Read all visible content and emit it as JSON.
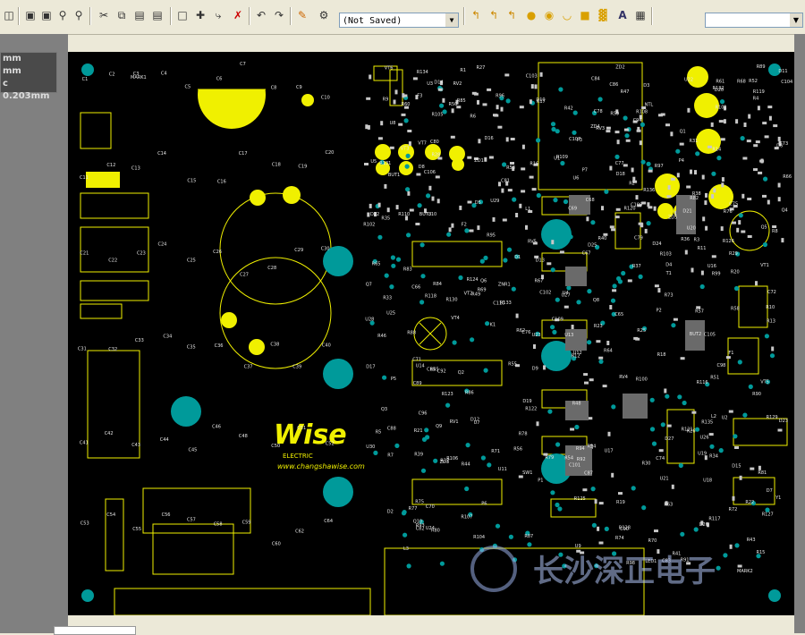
{
  "toolbar": {
    "document_select_value": "(Not Saved)",
    "icons": [
      "save-icon",
      "zoom-area-icon",
      "zoom-fit-icon",
      "zoom-in-icon",
      "zoom-selected-icon",
      "cut-icon",
      "copy-icon",
      "paste-icon",
      "paste-special-icon",
      "select-rect-icon",
      "move-icon",
      "rubber-stamp-icon",
      "cross-probe-icon",
      "undo-icon",
      "redo-icon",
      "highlight-icon",
      "net-icon",
      "interactive-route-icon",
      "diff-pair-icon",
      "multi-route-icon",
      "place-via-icon",
      "place-pad-icon",
      "place-arc-icon",
      "place-fill-icon",
      "place-string-icon",
      "text-icon",
      "place-component-icon"
    ]
  },
  "hud": {
    "line1": "mm",
    "line2": "mm",
    "line3": "c 0.203mm"
  },
  "board": {
    "silk_logo_text": "Wise",
    "website": "www.changshawise.com",
    "sub_logo": "ELECTRIC",
    "mark1": "MARK1",
    "mark2": "MARK2",
    "watermark": "长沙深正电子",
    "labels": [
      "C1",
      "C2",
      "C3",
      "C4",
      "C5",
      "C6",
      "C7",
      "C8",
      "C9",
      "C10",
      "C11",
      "C12",
      "C13",
      "C14",
      "C15",
      "C16",
      "C17",
      "C18",
      "C19",
      "C20",
      "C21",
      "C22",
      "C23",
      "C24",
      "C25",
      "C26",
      "C27",
      "C28",
      "C29",
      "C30",
      "C31",
      "C32",
      "C33",
      "C34",
      "C35",
      "C36",
      "C37",
      "C38",
      "C39",
      "C40",
      "C41",
      "C42",
      "C43",
      "C44",
      "C45",
      "C46",
      "C48",
      "C50",
      "C51",
      "C52",
      "C53",
      "C54",
      "C55",
      "C56",
      "C57",
      "C58",
      "C59",
      "C60",
      "C62",
      "C64",
      "C65",
      "C66",
      "C67",
      "C68",
      "C69",
      "C70",
      "C71",
      "C72",
      "C73",
      "C74",
      "C75",
      "C76",
      "C77",
      "C78",
      "C79",
      "C80",
      "C81",
      "C82",
      "C83",
      "C84",
      "C85",
      "C86",
      "C87",
      "C88",
      "C89",
      "C90",
      "C92",
      "C94",
      "C96",
      "C98",
      "C101",
      "C102",
      "C103",
      "C104",
      "C105",
      "C106",
      "C107",
      "C108",
      "C109",
      "C110",
      "R1",
      "R2",
      "R3",
      "R4",
      "R5",
      "R6",
      "R7",
      "R8",
      "R9",
      "R10",
      "R11",
      "R12",
      "R13",
      "R14",
      "R15",
      "R16",
      "R17",
      "R18",
      "R19",
      "R20",
      "R21",
      "R22",
      "R23",
      "R24",
      "R25",
      "R26",
      "R27",
      "R28",
      "R29",
      "R30",
      "R31",
      "R32",
      "R33",
      "R34",
      "R35",
      "R36",
      "R37",
      "R38",
      "R39",
      "R40",
      "R41",
      "R42",
      "R43",
      "R44",
      "R45",
      "R46",
      "R47",
      "R48",
      "R49",
      "R50",
      "R51",
      "R52",
      "R53",
      "R54",
      "R55",
      "R56",
      "R57",
      "R58",
      "R59",
      "R60",
      "R61",
      "R62",
      "R63",
      "R64",
      "R65",
      "R66",
      "R67",
      "R68",
      "R69",
      "R70",
      "R71",
      "R72",
      "R73",
      "R74",
      "R75",
      "R76",
      "R77",
      "R78",
      "R79",
      "R80",
      "R81",
      "R82",
      "R83",
      "R84",
      "R85",
      "R86",
      "R87",
      "R88",
      "R89",
      "R90",
      "R91",
      "R92",
      "R93",
      "R94",
      "R95",
      "R96",
      "R97",
      "R98",
      "R99",
      "R100",
      "R101",
      "R102",
      "R103",
      "R104",
      "R105",
      "R106",
      "R107",
      "R108",
      "R109",
      "R110",
      "R116",
      "R117",
      "R118",
      "R119",
      "R120",
      "R121",
      "R122",
      "R123",
      "R124",
      "R125",
      "R126",
      "R127",
      "R128",
      "R129",
      "R130",
      "R131",
      "R132",
      "R133",
      "R134",
      "R135",
      "R136",
      "RV1",
      "RV2",
      "RV3",
      "RV4",
      "RV5",
      "ZNR1",
      "NTL",
      "LED1",
      "K1",
      "T1",
      "L1",
      "L2",
      "L3",
      "F1",
      "F2",
      "F3",
      "U1",
      "U2",
      "U3",
      "U4",
      "U5",
      "U6",
      "U7",
      "U8",
      "U9",
      "U10",
      "U11",
      "U12",
      "U13",
      "U14",
      "U16",
      "U17",
      "U18",
      "U19",
      "U20",
      "U21",
      "U22",
      "U23",
      "U24",
      "U25",
      "U26",
      "U27",
      "U28",
      "U29",
      "U30",
      "VT1",
      "VT2",
      "VT3",
      "VT4",
      "VT5",
      "VT6",
      "VT7",
      "Q1",
      "Q2",
      "Q3",
      "Q4",
      "Q5",
      "Q6",
      "Q7",
      "Q8",
      "Q9",
      "Q10",
      "D1",
      "D2",
      "D3",
      "D4",
      "D5",
      "D6",
      "D7",
      "D8",
      "D9",
      "D10",
      "D11",
      "D12",
      "D13",
      "D14",
      "D15",
      "D16",
      "D17",
      "D18",
      "D19",
      "D20",
      "D21",
      "D22",
      "D23",
      "D24",
      "D25",
      "D26",
      "D27",
      "ZD1",
      "ZD2",
      "ZD3",
      "ZD4",
      "ZD5",
      "P1",
      "P2",
      "P3",
      "P4",
      "P5",
      "P6",
      "P7",
      "Y1",
      "SW1",
      "BUT1",
      "BUT2",
      "BUT3"
    ]
  },
  "colors": {
    "board": "#000000",
    "silk": "#f0f000",
    "pad": "#c8c8c8",
    "via": "#009a9a",
    "label": "#e8e8e8"
  }
}
